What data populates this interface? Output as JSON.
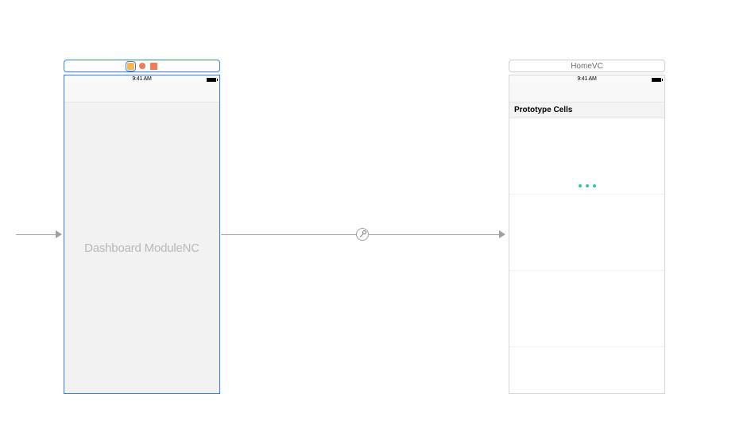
{
  "time": "9:41 AM",
  "scene_left": {
    "watermark": "Dashboard ModuleNC"
  },
  "scene_right": {
    "title": "HomeVC",
    "section_header": "Prototype Cells"
  }
}
